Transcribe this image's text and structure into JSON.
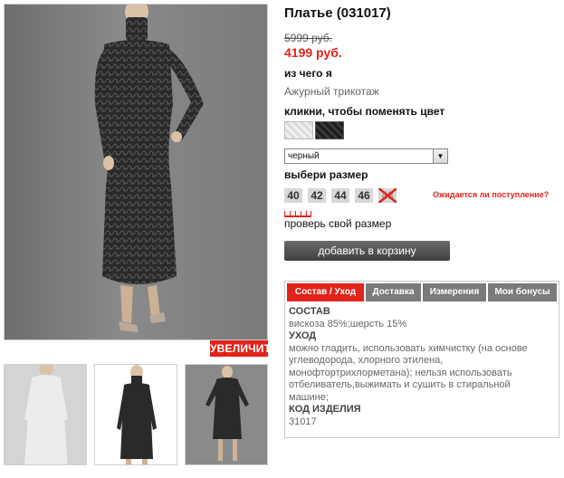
{
  "product": {
    "title": "Платье (031017)",
    "old_price": "5999 руб.",
    "new_price": "4199 руб."
  },
  "gallery": {
    "zoom_label": "УВЕЛИЧИТЬ",
    "thumbnails": [
      "white-dress-thumb",
      "black-dress-front-thumb",
      "black-dress-full-thumb"
    ]
  },
  "material": {
    "label": "из чего я",
    "value": "Ажурный трикотаж"
  },
  "color": {
    "label": "кликни, чтобы поменять цвет",
    "swatches": [
      "светлый",
      "черный"
    ],
    "selected": "черный"
  },
  "size": {
    "label": "выбери размер",
    "options": [
      "40",
      "42",
      "44",
      "46",
      "48"
    ],
    "unavailable": [
      "48"
    ],
    "notify_link": "Ожидается ли поступление?",
    "size_check_link": "проверь свой размер"
  },
  "cart": {
    "button_label": "добавить в корзину"
  },
  "tabs": {
    "items": [
      "Состав / Уход",
      "Доставка",
      "Измерения",
      "Мои бонусы"
    ],
    "active": "Состав / Уход",
    "content": {
      "composition_heading": "СОСТАВ",
      "composition": "вискоза 85%;шерсть 15%",
      "care_heading": "УХОД",
      "care_line1": "можно гладить, использовать химчистку (на основе",
      "care_line2": "углеводорода, хлорного этилена,",
      "care_line3": "монофтортрихлорметана); нельзя использовать",
      "care_line4": "отбеливатель,выжимать и сушить в стиральной",
      "care_line5": "машине;",
      "code_heading": "КОД ИЗДЕЛИЯ",
      "code": "31017"
    }
  },
  "colors": {
    "accent": "#e2231a",
    "button": "#4a4a4a",
    "tab_inactive": "#7a7a7a"
  }
}
